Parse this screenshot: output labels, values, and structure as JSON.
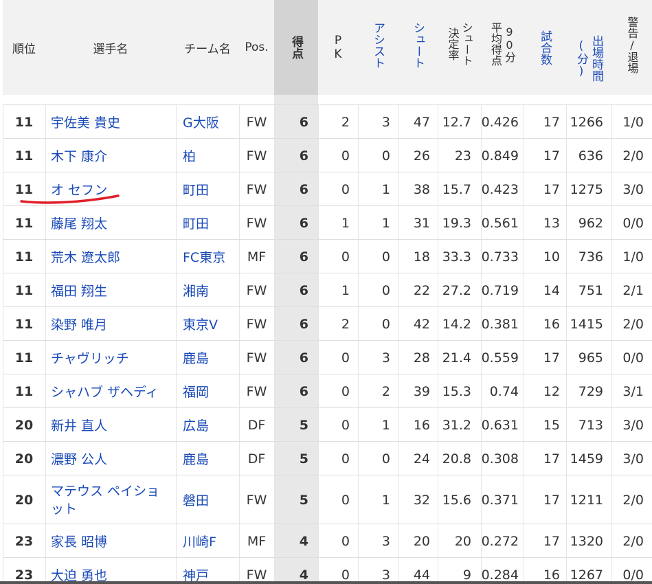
{
  "header": {
    "rank": "順位",
    "player": "選手名",
    "team": "チーム名",
    "pos": "Pos.",
    "goals": "得点",
    "pk": "PK",
    "assist": "アシスト",
    "shoot": "シュート",
    "shoot_rate_1": "シュート",
    "shoot_rate_2": "決定率",
    "per90_1": "平均得点",
    "per90_2": "90分",
    "games": "試合数",
    "minutes": "出場時間(分)",
    "cards": "警告/退場"
  },
  "rows": [
    {
      "rank": "11",
      "name": "宇佐美 貴史",
      "team": "G大阪",
      "pos": "FW",
      "goals": "6",
      "pk": "2",
      "assist": "3",
      "shots": "47",
      "rate": "12.7",
      "per90": "0.426",
      "games": "17",
      "minutes": "1266",
      "cards": "1/0"
    },
    {
      "rank": "11",
      "name": "木下 康介",
      "team": "柏",
      "pos": "FW",
      "goals": "6",
      "pk": "0",
      "assist": "0",
      "shots": "26",
      "rate": "23",
      "per90": "0.849",
      "games": "17",
      "minutes": "636",
      "cards": "2/0"
    },
    {
      "rank": "11",
      "name": "オ セフン",
      "team": "町田",
      "pos": "FW",
      "goals": "6",
      "pk": "0",
      "assist": "1",
      "shots": "38",
      "rate": "15.7",
      "per90": "0.423",
      "games": "17",
      "minutes": "1275",
      "cards": "3/0"
    },
    {
      "rank": "11",
      "name": "藤尾 翔太",
      "team": "町田",
      "pos": "FW",
      "goals": "6",
      "pk": "1",
      "assist": "1",
      "shots": "31",
      "rate": "19.3",
      "per90": "0.561",
      "games": "13",
      "minutes": "962",
      "cards": "0/0"
    },
    {
      "rank": "11",
      "name": "荒木 遼太郎",
      "team": "FC東京",
      "pos": "MF",
      "goals": "6",
      "pk": "0",
      "assist": "0",
      "shots": "18",
      "rate": "33.3",
      "per90": "0.733",
      "games": "10",
      "minutes": "736",
      "cards": "1/0"
    },
    {
      "rank": "11",
      "name": "福田 翔生",
      "team": "湘南",
      "pos": "FW",
      "goals": "6",
      "pk": "1",
      "assist": "0",
      "shots": "22",
      "rate": "27.2",
      "per90": "0.719",
      "games": "14",
      "minutes": "751",
      "cards": "2/1"
    },
    {
      "rank": "11",
      "name": "染野 唯月",
      "team": "東京V",
      "pos": "FW",
      "goals": "6",
      "pk": "2",
      "assist": "0",
      "shots": "42",
      "rate": "14.2",
      "per90": "0.381",
      "games": "16",
      "minutes": "1415",
      "cards": "2/0"
    },
    {
      "rank": "11",
      "name": "チャヴリッチ",
      "team": "鹿島",
      "pos": "FW",
      "goals": "6",
      "pk": "0",
      "assist": "3",
      "shots": "28",
      "rate": "21.4",
      "per90": "0.559",
      "games": "17",
      "minutes": "965",
      "cards": "0/0"
    },
    {
      "rank": "11",
      "name": "シャハブ ザヘディ",
      "team": "福岡",
      "pos": "FW",
      "goals": "6",
      "pk": "0",
      "assist": "2",
      "shots": "39",
      "rate": "15.3",
      "per90": "0.74",
      "games": "12",
      "minutes": "729",
      "cards": "3/1"
    },
    {
      "rank": "20",
      "name": "新井 直人",
      "team": "広島",
      "pos": "DF",
      "goals": "5",
      "pk": "0",
      "assist": "1",
      "shots": "16",
      "rate": "31.2",
      "per90": "0.631",
      "games": "15",
      "minutes": "713",
      "cards": "3/0"
    },
    {
      "rank": "20",
      "name": "濃野 公人",
      "team": "鹿島",
      "pos": "DF",
      "goals": "5",
      "pk": "0",
      "assist": "0",
      "shots": "24",
      "rate": "20.8",
      "per90": "0.308",
      "games": "17",
      "minutes": "1459",
      "cards": "3/0"
    },
    {
      "rank": "20",
      "name": "マテウス ペイショット",
      "team": "磐田",
      "pos": "FW",
      "goals": "5",
      "pk": "0",
      "assist": "1",
      "shots": "32",
      "rate": "15.6",
      "per90": "0.371",
      "games": "17",
      "minutes": "1211",
      "cards": "2/0"
    },
    {
      "rank": "23",
      "name": "家長 昭博",
      "team": "川崎F",
      "pos": "MF",
      "goals": "4",
      "pk": "0",
      "assist": "3",
      "shots": "20",
      "rate": "20",
      "per90": "0.272",
      "games": "17",
      "minutes": "1320",
      "cards": "2/0"
    },
    {
      "rank": "23",
      "name": "大迫 勇也",
      "team": "神戸",
      "pos": "FW",
      "goals": "4",
      "pk": "0",
      "assist": "3",
      "shots": "44",
      "rate": "9",
      "per90": "0.284",
      "games": "16",
      "minutes": "1267",
      "cards": "0/0"
    }
  ],
  "annotation": {
    "color": "#e0202a"
  }
}
